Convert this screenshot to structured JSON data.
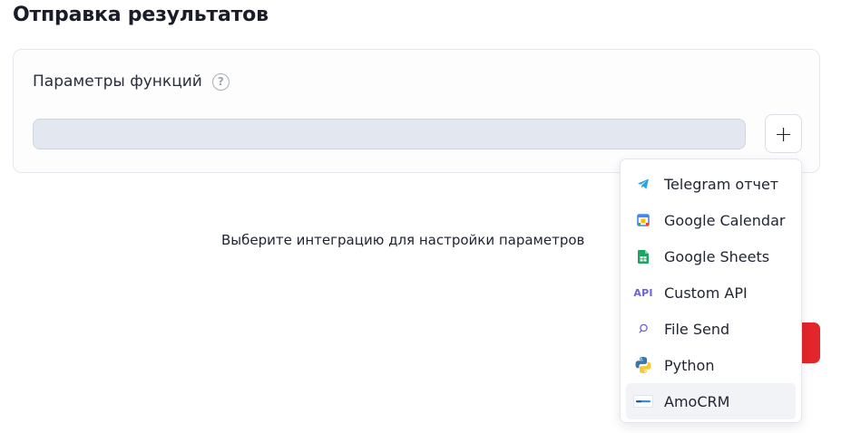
{
  "section": {
    "title": "Отправка результатов"
  },
  "card": {
    "label": "Параметры функций",
    "help_glyph": "?",
    "add_glyph": "+"
  },
  "hint": "Выберите интеграцию для настройки параметров",
  "dropdown": {
    "items": [
      {
        "label": "Telegram отчет",
        "icon": "telegram-icon"
      },
      {
        "label": "Google Calendar",
        "icon": "google-calendar-icon"
      },
      {
        "label": "Google Sheets",
        "icon": "google-sheets-icon"
      },
      {
        "label": "Custom API",
        "icon": "api-icon",
        "icon_text": "API"
      },
      {
        "label": "File Send",
        "icon": "file-send-icon"
      },
      {
        "label": "Python",
        "icon": "python-icon"
      },
      {
        "label": "AmoCRM",
        "icon": "amocrm-icon"
      }
    ],
    "active_index": 6
  },
  "colors": {
    "accent_red": "#e3262b",
    "input_bg": "#e3e8f0",
    "telegram": "#2aa3de",
    "sheets": "#1fa463",
    "api": "#6b63d9"
  }
}
